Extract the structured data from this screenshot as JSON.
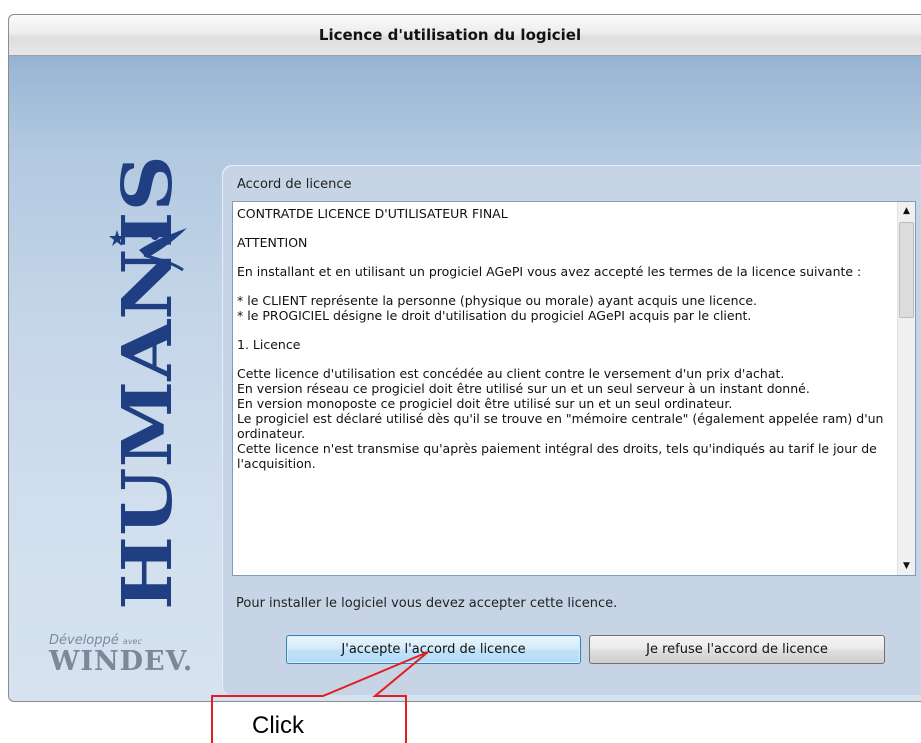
{
  "window": {
    "title": "Licence d'utilisation du logiciel"
  },
  "brand": {
    "name": "HUMANIS",
    "developer_small": "Développé",
    "developer_tag": "avec",
    "developer_big": "WINDEV."
  },
  "license": {
    "group_label": "Accord de licence",
    "paragraphs": [
      "CONTRATDE LICENCE D'UTILISATEUR FINAL",
      "ATTENTION",
      "En installant et en utilisant un progiciel AGePI vous avez accepté les termes de la licence suivante :"
    ],
    "definitions": [
      "* le CLIENT représente la personne (physique ou morale) ayant acquis une licence.",
      "* le PROGICIEL désigne le droit d'utilisation du progiciel AGePI acquis par le client."
    ],
    "section_title": "1. Licence",
    "section_lines": [
      "Cette licence d'utilisation est concédée au client contre le versement d'un prix d'achat.",
      "En version réseau ce progiciel doit être utilisé sur un et un seul serveur à un instant donné.",
      "En version monoposte ce progiciel doit être utilisé sur un et un seul ordinateur.",
      "Le progiciel est déclaré utilisé dès qu'il se trouve en \"mémoire centrale\" (également appelée ram) d'un ordinateur.",
      "Cette licence n'est transmise qu'après paiement intégral des droits, tels qu'indiqués au tarif le jour de l'acquisition."
    ],
    "instruction": "Pour installer le logiciel vous devez accepter cette licence."
  },
  "buttons": {
    "accept": "J'accepte l'accord de licence",
    "refuse": "Je refuse l'accord de licence"
  },
  "annotation": {
    "label": "Click",
    "color": "#e02020"
  },
  "icons": {
    "scroll_up": "up-arrow-icon",
    "scroll_down": "down-arrow-icon",
    "brand": "star-figure-icon"
  }
}
